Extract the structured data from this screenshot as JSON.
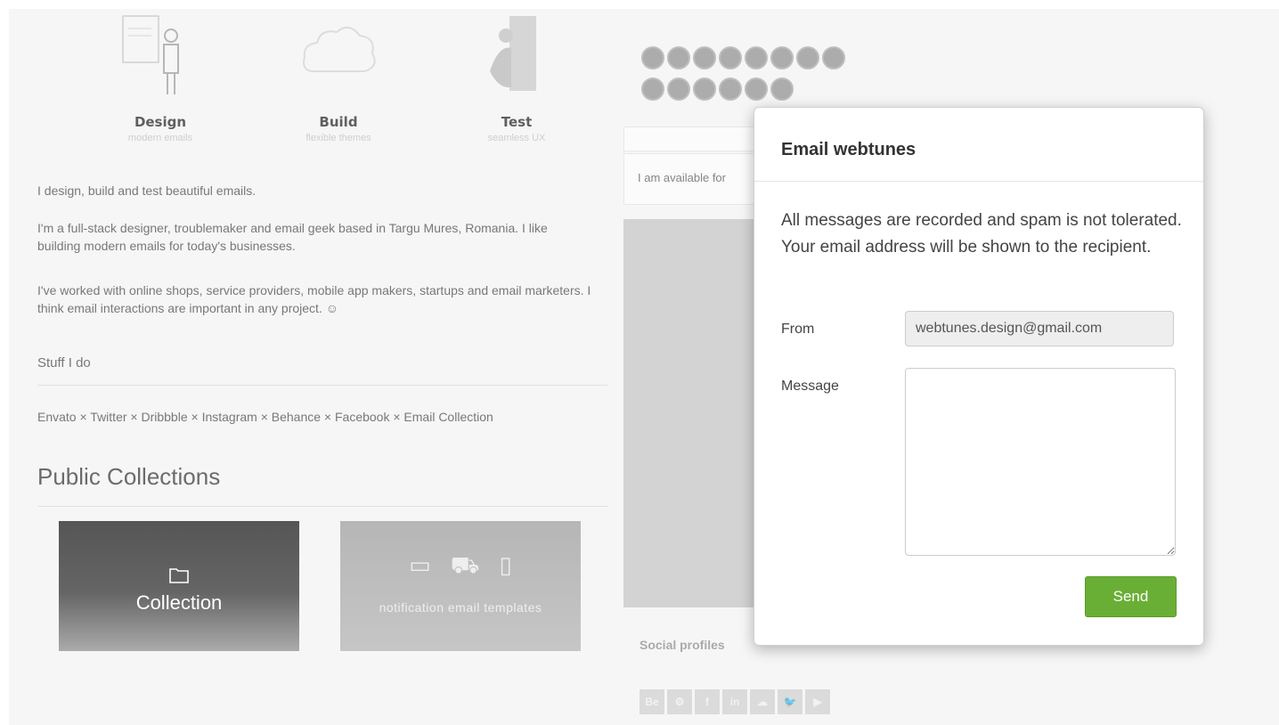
{
  "features": [
    {
      "title": "Design",
      "subtitle": "modern emails"
    },
    {
      "title": "Build",
      "subtitle": "flexible themes"
    },
    {
      "title": "Test",
      "subtitle": "seamless UX"
    }
  ],
  "about": {
    "p1": "I design, build and test beautiful emails.",
    "p2": "I'm a full-stack designer, troublemaker and email geek based in Targu Mures, Romania. I like building modern emails for today's businesses.",
    "p3": "I've worked with online shops, service providers, mobile app makers, startups and email marketers. I think email interactions are important in any project. ☺",
    "stuff_heading": "Stuff I do",
    "links": "Envato × Twitter × Dribbble × Instagram × Behance × Facebook × Email Collection"
  },
  "collections": {
    "heading": "Public Collections",
    "cards": [
      {
        "label": "Collection"
      },
      {
        "label": "notification email templates"
      }
    ]
  },
  "sidebar": {
    "availability": "I am available for",
    "social_heading": "Social profiles",
    "social_icons": [
      "Be",
      "⚙",
      "f",
      "in",
      "☁",
      "🐦",
      "▶"
    ]
  },
  "modal": {
    "title": "Email webtunes",
    "notice": "All messages are recorded and spam is not tolerated. Your email address will be shown to the recipient.",
    "from_label": "From",
    "from_value": "webtunes.design@gmail.com",
    "message_label": "Message",
    "message_value": "",
    "send_label": "Send"
  },
  "colors": {
    "send": "#6aaf35"
  }
}
